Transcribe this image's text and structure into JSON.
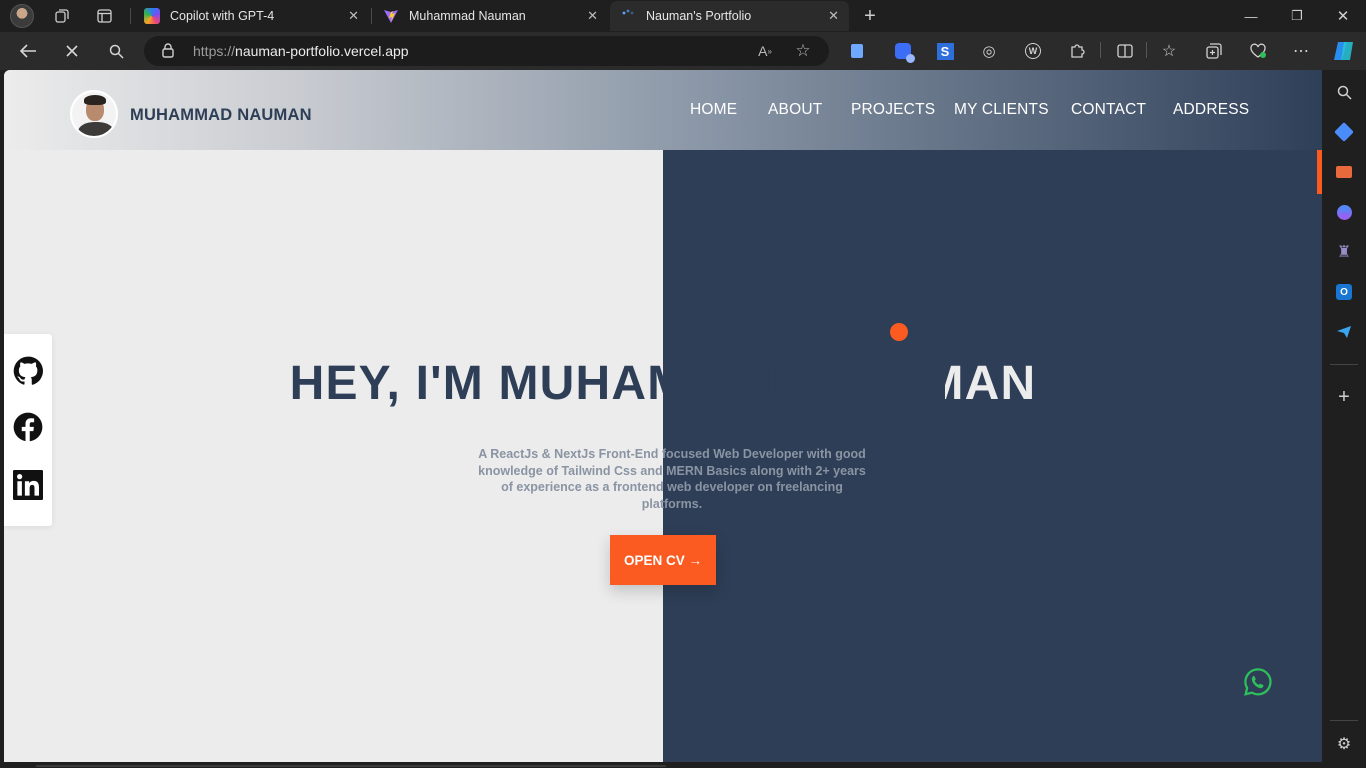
{
  "browser": {
    "tabs": [
      {
        "title": "Copilot with GPT-4",
        "active": false,
        "favicon": "copilot-icon"
      },
      {
        "title": "Muhammad Nauman",
        "active": false,
        "favicon": "vite-icon"
      },
      {
        "title": "Nauman's Portfolio",
        "active": true,
        "favicon": "loading-icon"
      }
    ],
    "url_prefix": "https://",
    "url_host": "nauman-portfolio.vercel.app"
  },
  "site": {
    "brand_name": "MUHAMMAD NAUMAN",
    "nav": [
      "HOME",
      "ABOUT",
      "PROJECTS",
      "MY CLIENTS",
      "CONTACT",
      "ADDRESS"
    ],
    "headline": "HEY, I'M MUHAMMAD NAUMAN",
    "blurb": "A ReactJs & NextJs Front-End focused Web Developer with good knowledge of Tailwind Css and MERN Basics along with 2+ years of experience as a frontend web developer on freelancing platforms.",
    "cta": "OPEN CV →",
    "social": [
      "github-icon",
      "facebook-icon",
      "linkedin-icon"
    ]
  },
  "colors": {
    "accent": "#fb5b21",
    "navy": "#2d3e56",
    "light": "#ececec"
  }
}
